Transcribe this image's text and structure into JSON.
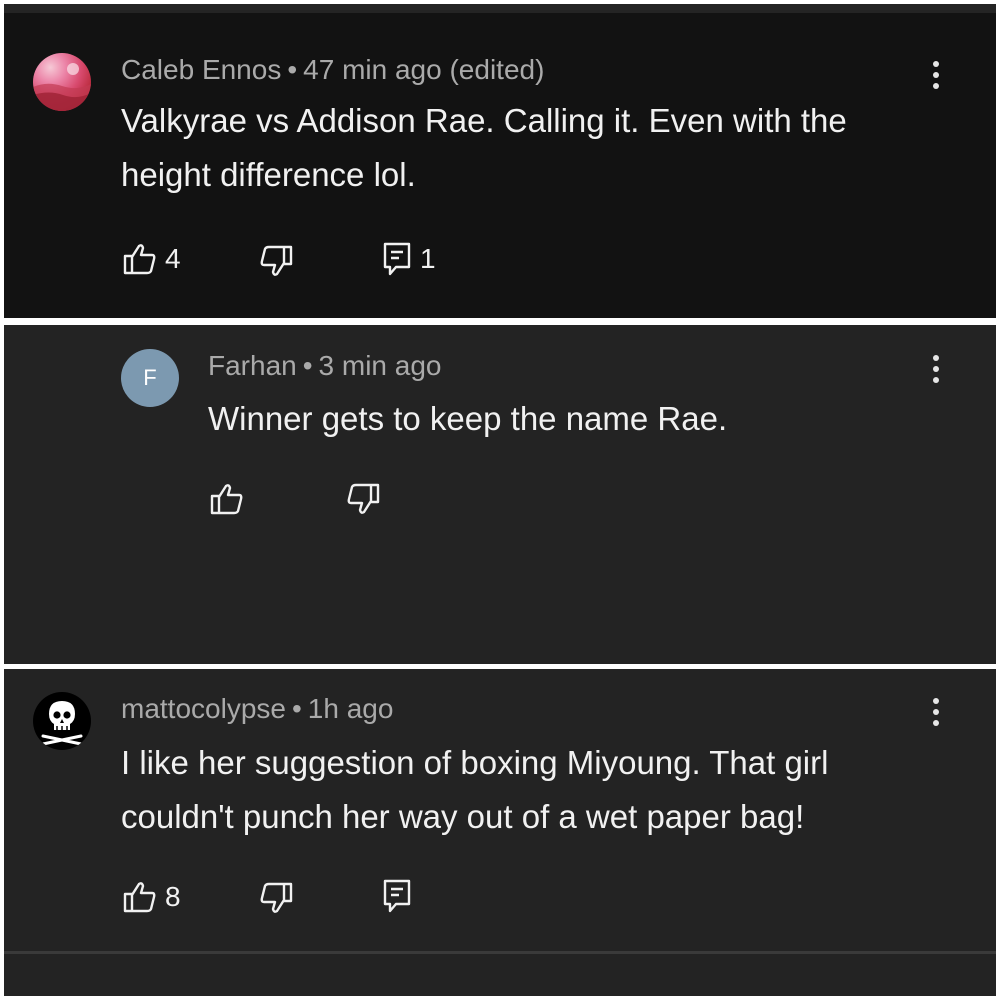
{
  "comments": [
    {
      "author": "Caleb Ennos",
      "time": "47 min ago (edited)",
      "text": "Valkyrae vs Addison Rae. Calling it. Even with the height difference lol.",
      "likes": "4",
      "replies": "1",
      "avatar_icon": "sunset-photo-avatar"
    },
    {
      "author": "Farhan",
      "time": "3 min ago",
      "text": "Winner gets to keep the name Rae.",
      "avatar_letter": "F",
      "avatar_color": "#7c99b0"
    },
    {
      "author": "mattocolypse",
      "time": "1h ago",
      "text": "I like her suggestion of boxing Miyoung. That girl couldn't punch her way out of a wet paper bag!",
      "likes": "8",
      "avatar_icon": "skull-crossbones-avatar"
    }
  ],
  "separator": "•",
  "icons": {
    "like": "thumbs-up-icon",
    "dislike": "thumbs-down-icon",
    "reply": "reply-icon",
    "more": "more-vert-icon"
  },
  "colors": {
    "background_dark": "#121212",
    "background_panel": "#232323",
    "text_primary": "#f1f1f1",
    "text_secondary": "#aaaaaa"
  }
}
